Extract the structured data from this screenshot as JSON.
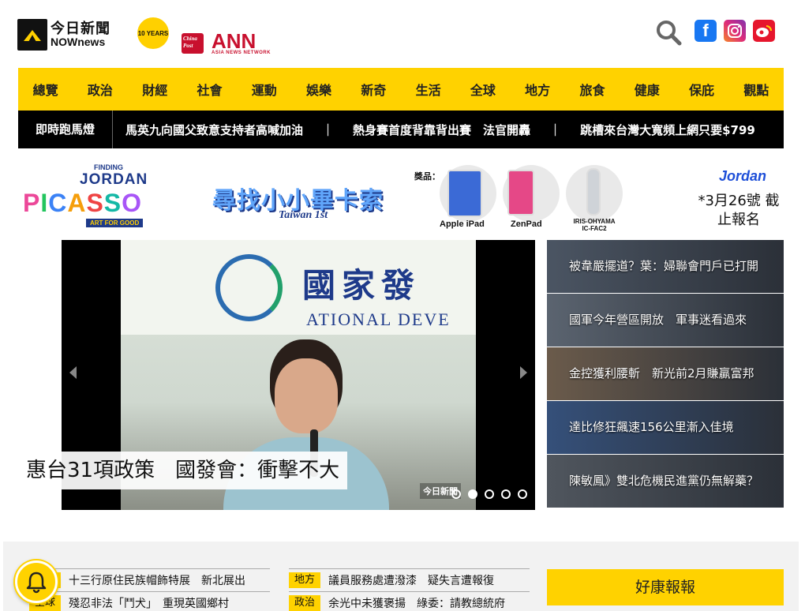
{
  "header": {
    "logo_cn": "今日新聞",
    "logo_en": "NOWnews",
    "logo_years": "10 YEARS",
    "partner_china_post": "China Post",
    "partner_ann": "ANN",
    "partner_ann_sub": "ASIA NEWS NETWORK",
    "icons": [
      "search-icon",
      "facebook-icon",
      "instagram-icon",
      "weibo-icon"
    ]
  },
  "nav": {
    "items": [
      "總覽",
      "政治",
      "財經",
      "社會",
      "運動",
      "娛樂",
      "新奇",
      "生活",
      "全球",
      "地方",
      "旅食",
      "健康",
      "保庇",
      "觀點"
    ]
  },
  "ticker": {
    "label": "即時跑馬燈",
    "items": [
      "馬英九向國父致意支持者高喊加油",
      "熱身賽首度背靠背出賽　法官開轟",
      "跳槽來台灣大寬頻上網只要$799"
    ],
    "separator": "｜"
  },
  "banner": {
    "finding": "FINDING",
    "jordan": "JORDAN",
    "picasso": [
      "P",
      "I",
      "C",
      "A",
      "S",
      "S",
      "O"
    ],
    "art_for_good": "ART FOR GOOD",
    "title": "尋找小小畢卡索",
    "subtitle": "Taiwan 1st",
    "prize_label": "獎品：",
    "prizes": [
      "Apple iPad",
      "ZenPad",
      "IRIS-OHYAMA IC-FAC2"
    ],
    "brand": "Jordan",
    "deadline": "*3月26號 截止報名"
  },
  "slider": {
    "caption": "惠台31項政策　國發會：衝擊不大",
    "photo_sign_cn": "國家發",
    "photo_sign_en": "ATIONAL DEVE",
    "watermark": "今日新聞",
    "dots_count": 5,
    "active_dot": 1
  },
  "side_list": {
    "items": [
      {
        "title": "被韋嚴擺道？葉：婦聯會門戶已打開",
        "color": "#4b5563"
      },
      {
        "title": "國軍今年營區開放　軍事迷看過來",
        "color": "#5b6470"
      },
      {
        "title": "金控獲利腰斬　新光前2月賺贏富邦",
        "color": "#6b5b4b"
      },
      {
        "title": "達比修狂飆速156公里漸入佳境",
        "color": "#35507a"
      },
      {
        "title": "陳敏鳳》雙北危機民進黨仍無解藥？",
        "color": "#50565e"
      }
    ]
  },
  "bottom": {
    "col1": [
      {
        "tag": "全球",
        "title": "十三行原住民族帽飾特展　新北展出"
      },
      {
        "tag": "全球",
        "title": "殘忍非法「鬥犬」　重現英國鄉村"
      }
    ],
    "col2": [
      {
        "tag": "地方",
        "title": "議員服務處遭潑漆　疑失言遭報復"
      },
      {
        "tag": "政治",
        "title": "余光中未獲褒揚　綠委：請教總統府"
      }
    ],
    "good_news": "好康報報"
  },
  "colors": {
    "accent": "#ffd200",
    "ticker_bg": "#000000"
  }
}
